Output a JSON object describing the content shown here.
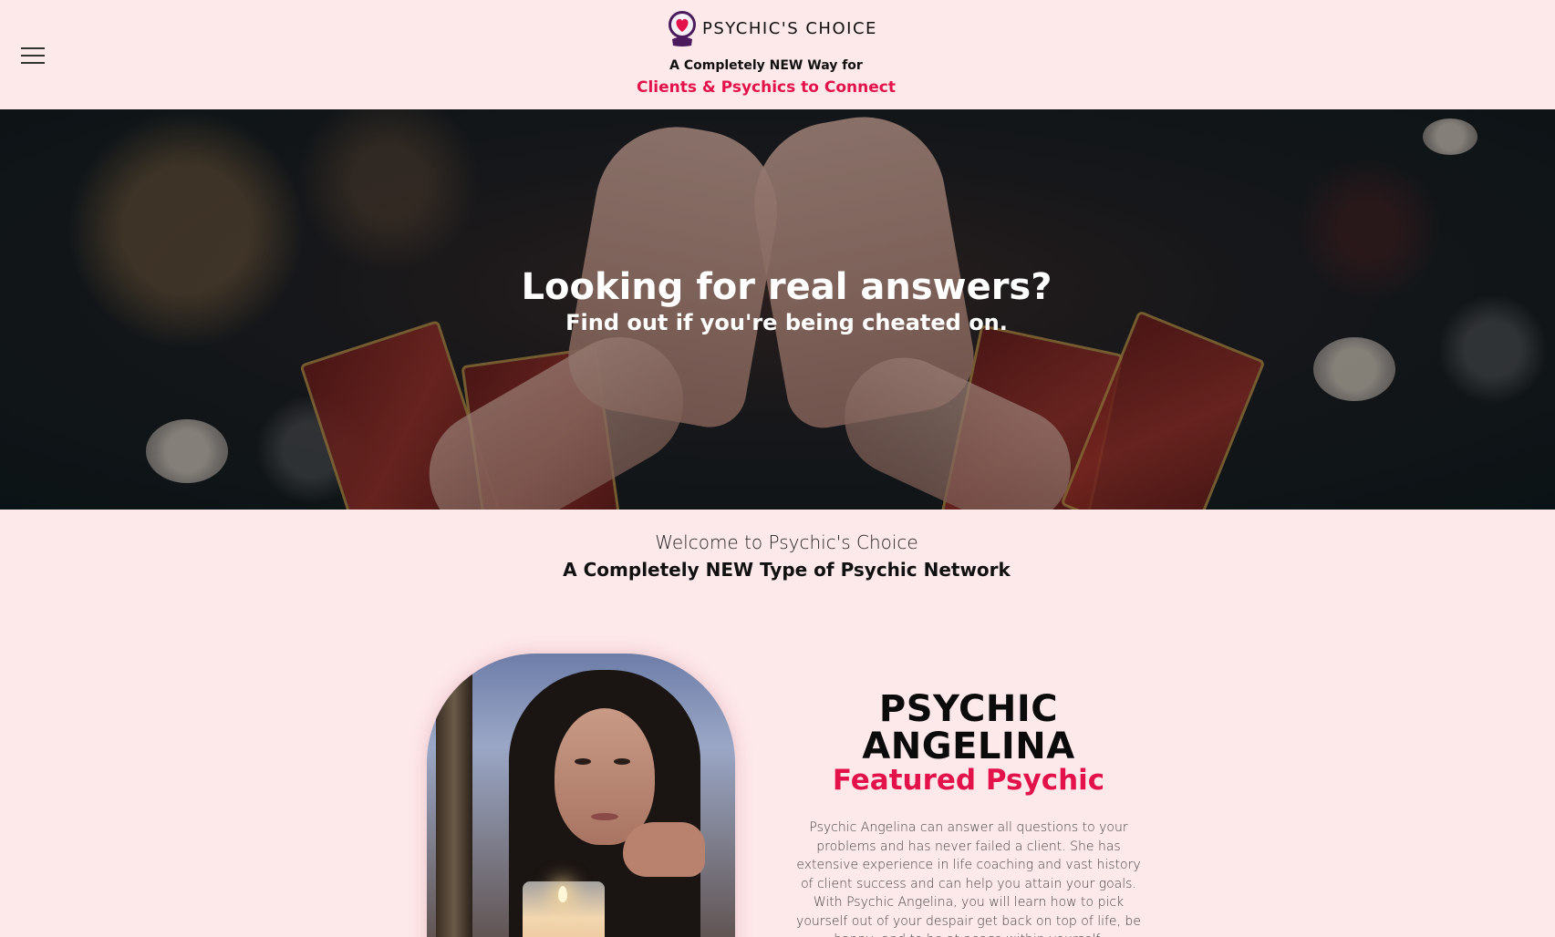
{
  "header": {
    "brand_name": "PSYCHIC'S CHOICE",
    "tagline_line1": "A Completely NEW Way for",
    "tagline_line2": "Clients & Psychics to Connect",
    "accent_color": "#e3124a"
  },
  "hero": {
    "title": "Looking for real answers?",
    "subtitle": "Find out if you're being cheated on."
  },
  "welcome": {
    "title": "Welcome to Psychic's  Choice",
    "subtitle": "A Completely NEW Type of Psychic Network"
  },
  "featured": {
    "name": "PSYCHIC ANGELINA",
    "label": "Featured Psychic",
    "description": "Psychic Angelina can answer all questions to your problems and has never failed a client. She has extensive experience in life coaching and vast history of client success and can help you attain your goals. With Psychic Angelina, you will learn how to pick yourself out of your despair get back on top of life, be happy, and to be at peace within yourself."
  },
  "icons": {
    "menu": "hamburger-menu-icon",
    "logo": "crystal-ball-heart-icon"
  }
}
